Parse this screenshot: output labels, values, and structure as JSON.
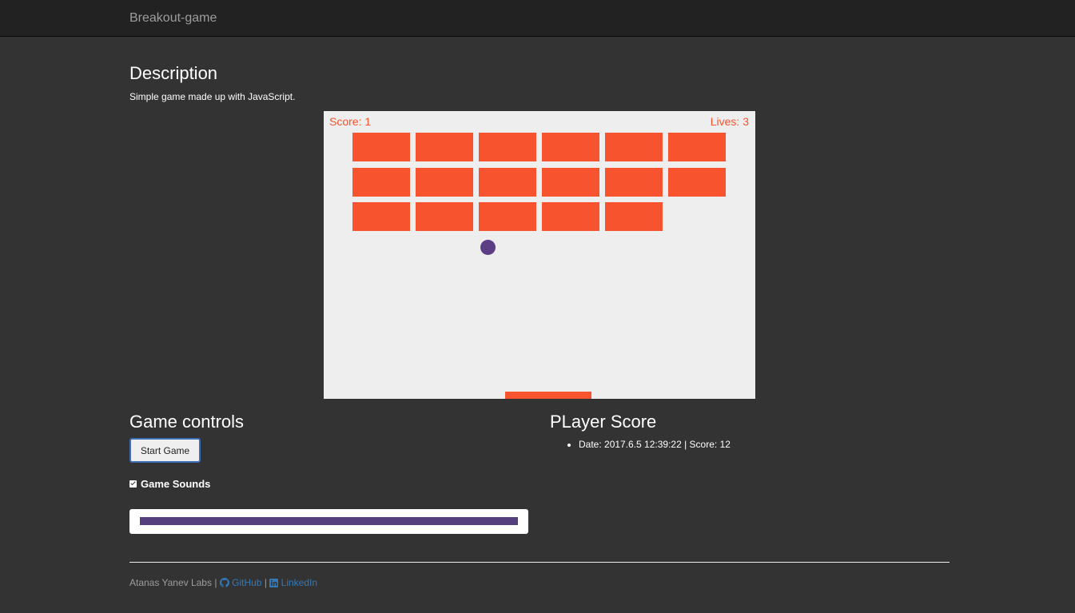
{
  "navbar": {
    "brand": "Breakout-game"
  },
  "description": {
    "title": "Description",
    "text": "Simple game made up with JavaScript."
  },
  "game": {
    "score_text": "Score: 1",
    "lives_text": "Lives: 3",
    "score": 1,
    "lives": 3,
    "brick_rows": [
      [
        true,
        true,
        true,
        true,
        true,
        true
      ],
      [
        true,
        true,
        true,
        true,
        true,
        true
      ],
      [
        true,
        true,
        true,
        true,
        true,
        false
      ]
    ],
    "colors": {
      "background": "#eeeeee",
      "brick": "#f7532f",
      "ball": "#5c3e85",
      "paddle": "#f7532f",
      "hud": "#f7532f"
    }
  },
  "controls": {
    "title": "Game controls",
    "start_button_label": "Start Game",
    "sounds_label": "Game Sounds",
    "sounds_enabled": true,
    "volume_fraction": 1.0,
    "volume_color": "#55407d"
  },
  "player_score": {
    "title": "PLayer Score",
    "entries": [
      "Date: 2017.6.5 12:39:22 | Score: 12"
    ]
  },
  "footer": {
    "author": "Atanas Yanev Labs",
    "separator": "|",
    "github_label": "GitHub",
    "linkedin_label": "LinkedIn",
    "github_icon": "github-icon",
    "linkedin_icon": "linkedin-icon",
    "link_color": "#337ab7"
  }
}
